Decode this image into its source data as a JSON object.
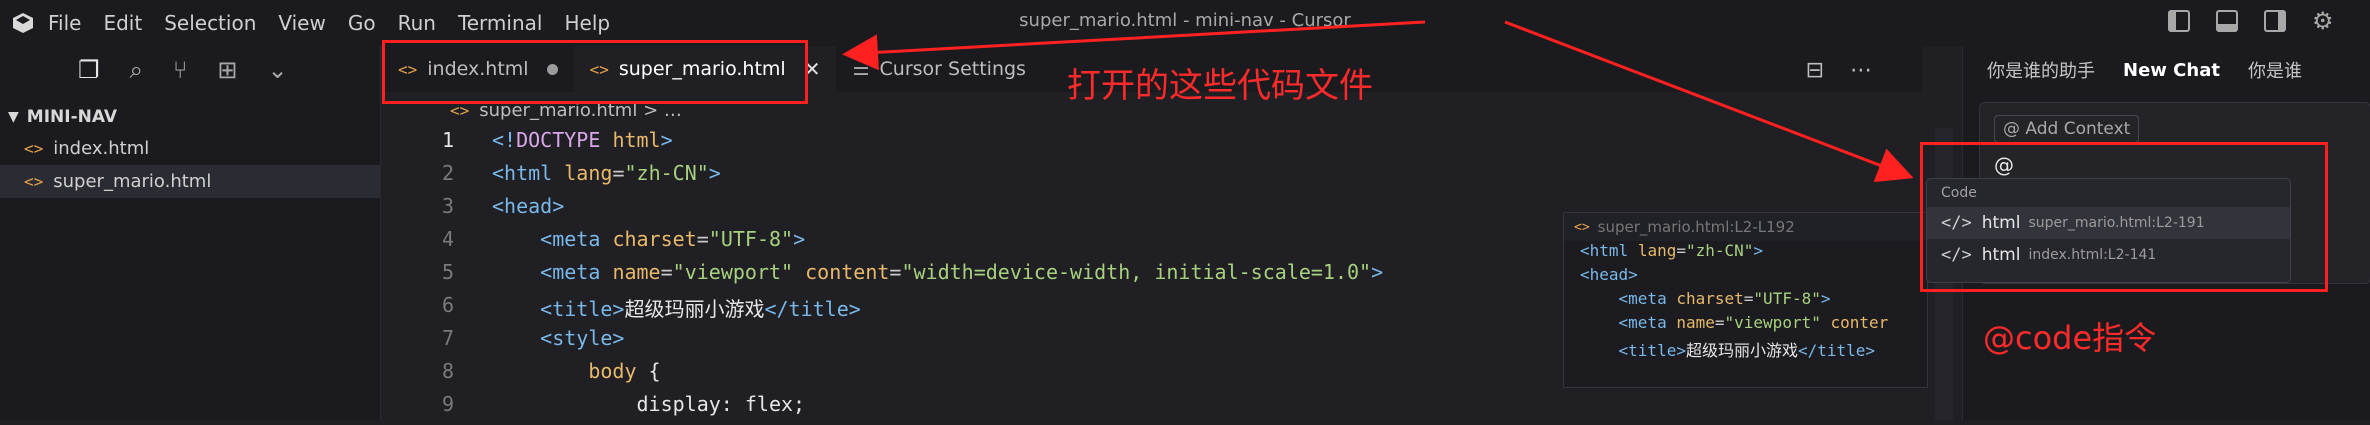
{
  "window": {
    "title": "super_mario.html - mini-nav - Cursor"
  },
  "menu": [
    "File",
    "Edit",
    "Selection",
    "View",
    "Go",
    "Run",
    "Terminal",
    "Help"
  ],
  "sidebar": {
    "section_title": "MINI-NAV",
    "files": [
      {
        "name": "index.html",
        "selected": false
      },
      {
        "name": "super_mario.html",
        "selected": true
      }
    ]
  },
  "tabs": [
    {
      "label": "index.html",
      "state": "modified"
    },
    {
      "label": "super_mario.html",
      "state": "active"
    },
    {
      "label": "Cursor Settings",
      "state": "normal"
    }
  ],
  "breadcrumb": {
    "file": "super_mario.html",
    "rest": "…"
  },
  "editor": {
    "lines": [
      {
        "n": "1",
        "html": "<span class='t'>&lt;!</span><span class='k'>DOCTYPE</span> <span class='a'>html</span><span class='t'>&gt;</span>"
      },
      {
        "n": "2",
        "html": "<span class='t'>&lt;html</span> <span class='a'>lang</span>=<span class='s'>\"zh-CN\"</span><span class='t'>&gt;</span>"
      },
      {
        "n": "3",
        "html": "<span class='t'>&lt;head&gt;</span>"
      },
      {
        "n": "4",
        "html": "    <span class='t'>&lt;meta</span> <span class='a'>charset</span>=<span class='s'>\"UTF-8\"</span><span class='t'>&gt;</span>"
      },
      {
        "n": "5",
        "html": "    <span class='t'>&lt;meta</span> <span class='a'>name</span>=<span class='s'>\"viewport\"</span> <span class='a'>content</span>=<span class='s'>\"width=device-width, initial-scale=1.0\"</span><span class='t'>&gt;</span>"
      },
      {
        "n": "6",
        "html": "    <span class='t'>&lt;title&gt;</span><span class='tx'>超级玛丽小游戏</span><span class='t'>&lt;/title&gt;</span>"
      },
      {
        "n": "7",
        "html": "    <span class='t'>&lt;style&gt;</span>"
      },
      {
        "n": "8",
        "html": "        <span class='a'>body</span> <span class='tx'>{</span>"
      },
      {
        "n": "9",
        "html": "            <span class='tx'>display: flex;</span>"
      }
    ]
  },
  "peek": {
    "title": "super_mario.html:L2-L192",
    "lines": [
      "<span class='t'>&lt;html</span> <span class='a'>lang</span>=<span class='s'>\"zh-CN\"</span><span class='t'>&gt;</span>",
      "<span class='t'>&lt;head&gt;</span>",
      "    <span class='t'>&lt;meta</span> <span class='a'>charset</span>=<span class='s'>\"UTF-8\"</span><span class='t'>&gt;</span>",
      "    <span class='t'>&lt;meta</span> <span class='a'>name</span>=<span class='s'>\"viewport\"</span> <span class='a'>conter</span>",
      "    <span class='t'>&lt;title&gt;</span><span class='tx'>超级玛丽小游戏</span><span class='t'>&lt;/title&gt;</span>"
    ]
  },
  "chat": {
    "tabs": [
      "你是谁的助手",
      "New Chat",
      "你是谁"
    ],
    "active_tab": "New Chat",
    "add_context": "Add Context",
    "input_value": "@"
  },
  "suggest": {
    "header": "Code",
    "items": [
      {
        "label": "html",
        "loc": "super_mario.html:L2-191"
      },
      {
        "label": "html",
        "loc": "index.html:L2-141"
      }
    ]
  },
  "annotations": {
    "tabs_note": "打开的这些代码文件",
    "code_note": "@code指令"
  },
  "colors": {
    "accent_red": "#ff2020",
    "tag_orange": "#e5a34a"
  }
}
